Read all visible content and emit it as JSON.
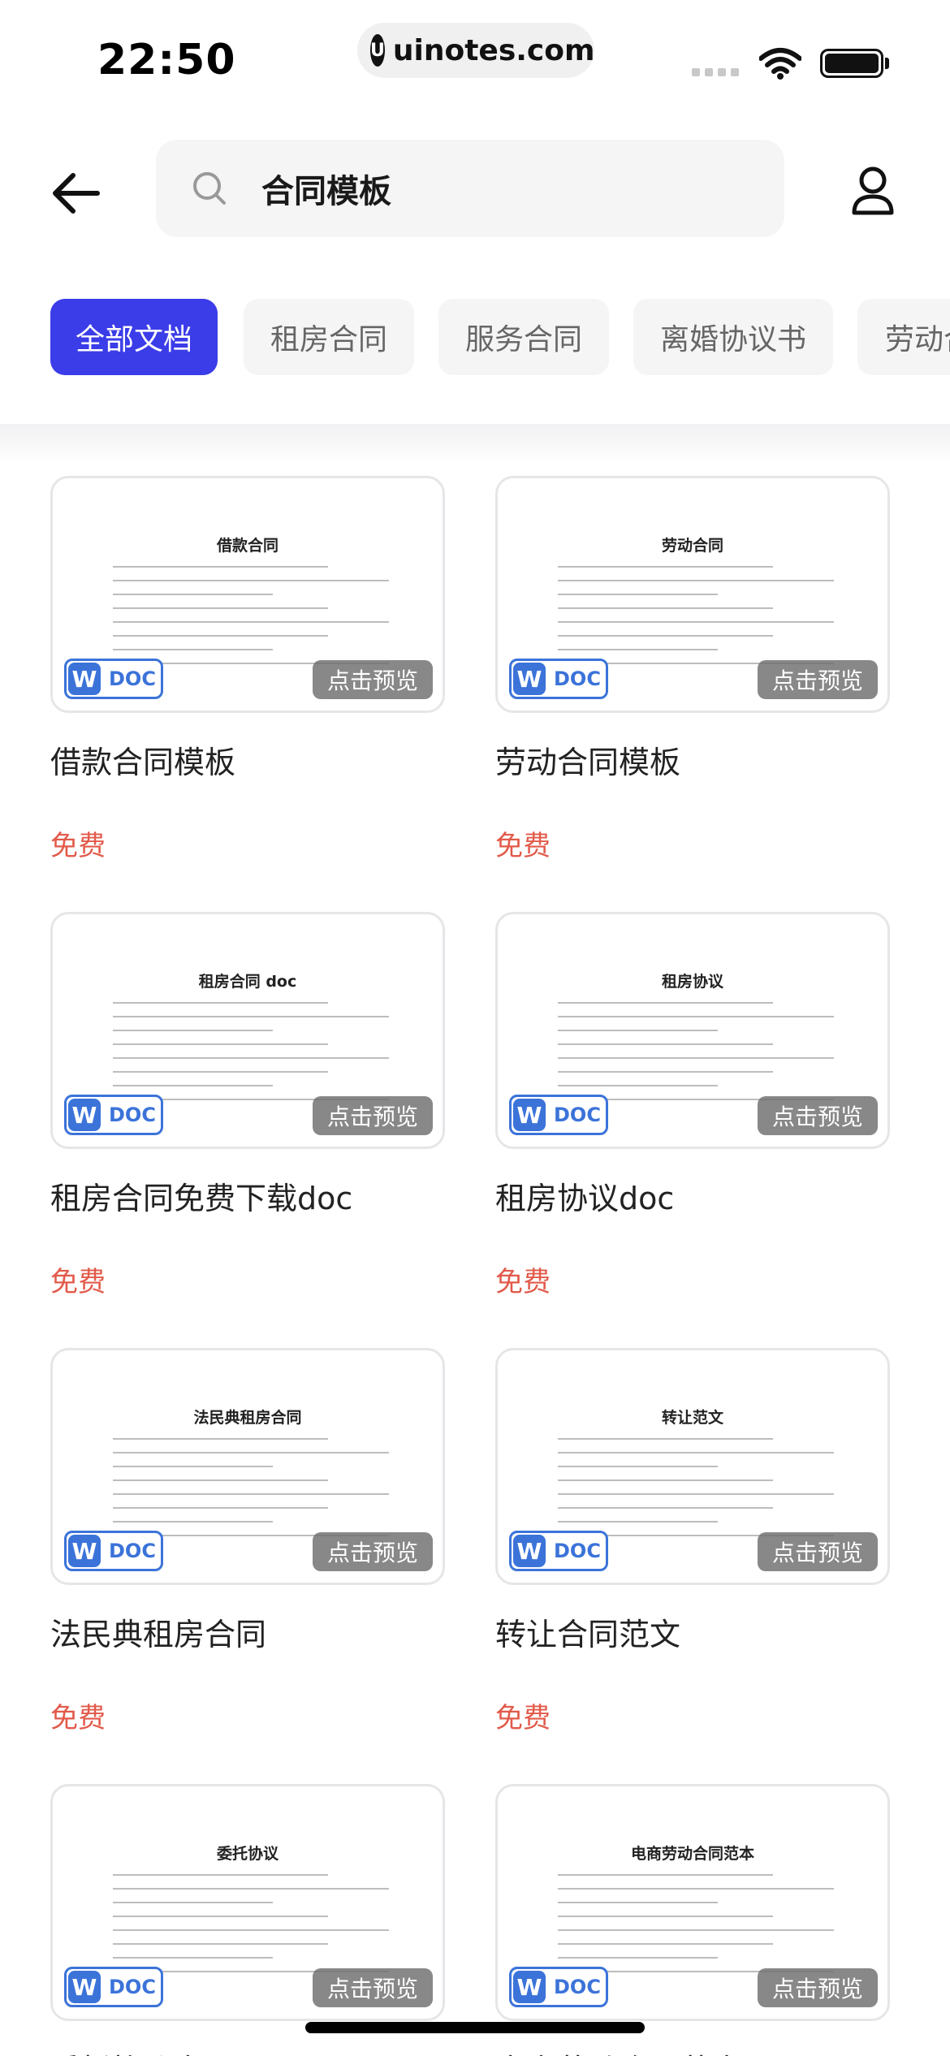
{
  "status_bar": {
    "time": "22:50",
    "url": "uinotes.com",
    "logo_letter": "U"
  },
  "header": {
    "search_query": "合同模板"
  },
  "tabs": [
    {
      "label": "全部文档",
      "active": true
    },
    {
      "label": "租房合同",
      "active": false
    },
    {
      "label": "服务合同",
      "active": false
    },
    {
      "label": "离婚协议书",
      "active": false
    },
    {
      "label": "劳动合",
      "active": false
    }
  ],
  "badge": {
    "w": "W",
    "doc": "DOC"
  },
  "preview_label": "点击预览",
  "cards": [
    {
      "thumb_title": "借款合同",
      "title": "借款合同模板",
      "price": "免费"
    },
    {
      "thumb_title": "劳动合同",
      "title": "劳动合同模板",
      "price": "免费"
    },
    {
      "thumb_title": "租房合同 doc",
      "title": "租房合同免费下载doc",
      "price": "免费"
    },
    {
      "thumb_title": "租房协议",
      "title": "租房协议doc",
      "price": "免费"
    },
    {
      "thumb_title": "法民典租房合同",
      "title": "法民典租房合同",
      "price": "免费"
    },
    {
      "thumb_title": "转让范文",
      "title": "转让合同范文",
      "price": "免费"
    },
    {
      "thumb_title": "委托协议",
      "title": "委托协议书",
      "price": ""
    },
    {
      "thumb_title": "电商劳动合同范本",
      "title": "电商劳动合同范本",
      "price": ""
    }
  ],
  "colors": {
    "accent": "#3b3de8",
    "price": "#e25a4a",
    "doc_blue": "#3b73d9"
  }
}
